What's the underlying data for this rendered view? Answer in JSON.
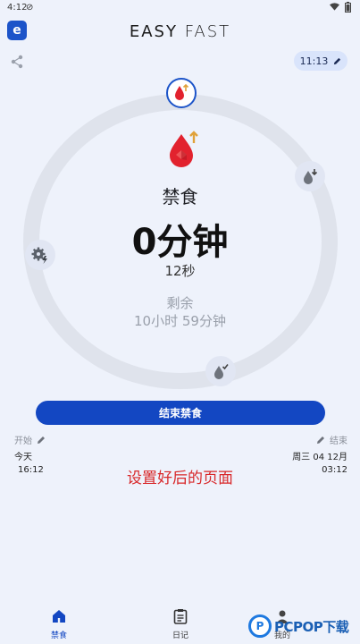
{
  "status_bar": {
    "time": "4:12"
  },
  "header": {
    "title_part1": "EASY",
    "title_part2": "FAST"
  },
  "time_pill": {
    "value": "11:13"
  },
  "fast": {
    "stage_label": "禁食",
    "elapsed_main": "0分钟",
    "elapsed_seconds": "12秒",
    "remaining_label": "剩余",
    "remaining_value": "10小时 59分钟"
  },
  "end_button": {
    "label": "结束禁食"
  },
  "start": {
    "label": "开始",
    "day": "今天",
    "time": "16:12"
  },
  "end": {
    "label": "结束",
    "day": "周三 04 12月",
    "time": "03:12"
  },
  "caption": "设置好后的页面",
  "nav": {
    "fast": "禁食",
    "diary": "日记",
    "profile": "我的"
  },
  "watermark": {
    "text": "PCPOP下载"
  },
  "colors": {
    "accent": "#1347c2",
    "drop_red": "#e2222e",
    "caption_red": "#d8282a"
  }
}
